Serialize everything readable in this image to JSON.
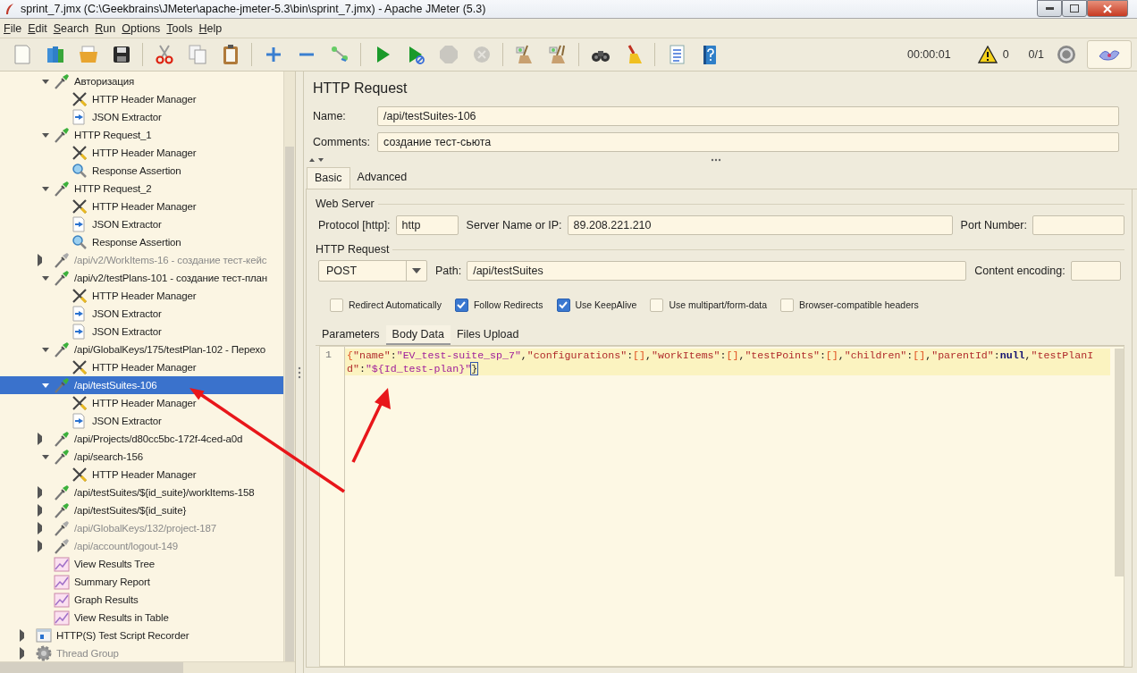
{
  "window": {
    "title": "sprint_7.jmx (C:\\Geekbrains\\JMeter\\apache-jmeter-5.3\\bin\\sprint_7.jmx) - Apache JMeter (5.3)"
  },
  "menu": [
    "File",
    "Edit",
    "Search",
    "Run",
    "Options",
    "Tools",
    "Help"
  ],
  "toolbar": [
    {
      "kind": "new",
      "disabled": false
    },
    {
      "kind": "templates",
      "disabled": false
    },
    {
      "kind": "open",
      "disabled": false
    },
    {
      "kind": "save",
      "disabled": false
    },
    {
      "kind": "separator"
    },
    {
      "kind": "cut",
      "disabled": false
    },
    {
      "kind": "copy",
      "disabled": false
    },
    {
      "kind": "paste",
      "disabled": false
    },
    {
      "kind": "separator"
    },
    {
      "kind": "expand",
      "disabled": false
    },
    {
      "kind": "collapse",
      "disabled": false
    },
    {
      "kind": "toggle",
      "disabled": false
    },
    {
      "kind": "separator"
    },
    {
      "kind": "start",
      "disabled": false
    },
    {
      "kind": "start-no-pause",
      "disabled": false
    },
    {
      "kind": "stop",
      "disabled": true
    },
    {
      "kind": "shutdown",
      "disabled": true
    },
    {
      "kind": "separator"
    },
    {
      "kind": "clear",
      "disabled": false
    },
    {
      "kind": "clear-all",
      "disabled": false
    },
    {
      "kind": "separator"
    },
    {
      "kind": "search",
      "disabled": false
    },
    {
      "kind": "reset-search",
      "disabled": false
    },
    {
      "kind": "separator"
    },
    {
      "kind": "function-helper",
      "disabled": false
    },
    {
      "kind": "help",
      "disabled": false
    }
  ],
  "status": {
    "timer": "00:00:01",
    "warnings": "0",
    "threads": "0/1"
  },
  "tree": {
    "items": [
      {
        "label": "Авторизация",
        "kind": "sampler",
        "expanded": true,
        "disabled": false,
        "selected": false,
        "children": [
          {
            "label": "HTTP Header Manager",
            "kind": "header",
            "disabled": false,
            "selected": false
          },
          {
            "label": "JSON Extractor",
            "kind": "extractor",
            "disabled": false,
            "selected": false
          }
        ]
      },
      {
        "label": "HTTP Request_1",
        "kind": "sampler",
        "expanded": true,
        "disabled": false,
        "selected": false,
        "children": [
          {
            "label": "HTTP Header Manager",
            "kind": "header",
            "disabled": false,
            "selected": false
          },
          {
            "label": "Response Assertion",
            "kind": "assertion",
            "disabled": false,
            "selected": false
          }
        ]
      },
      {
        "label": "HTTP Request_2",
        "kind": "sampler",
        "expanded": true,
        "disabled": false,
        "selected": false,
        "children": [
          {
            "label": "HTTP Header Manager",
            "kind": "header",
            "disabled": false,
            "selected": false
          },
          {
            "label": "JSON Extractor",
            "kind": "extractor",
            "disabled": false,
            "selected": false
          },
          {
            "label": "Response Assertion",
            "kind": "assertion",
            "disabled": false,
            "selected": false
          }
        ]
      },
      {
        "label": "/api/v2/WorkItems-16 - создание тест-кейс",
        "kind": "sampler",
        "expanded": false,
        "disabled": true,
        "selected": false
      },
      {
        "label": "/api/v2/testPlans-101 - создание тест-план",
        "kind": "sampler",
        "expanded": true,
        "disabled": false,
        "selected": false,
        "children": [
          {
            "label": "HTTP Header Manager",
            "kind": "header",
            "disabled": false,
            "selected": false
          },
          {
            "label": "JSON Extractor",
            "kind": "extractor",
            "disabled": false,
            "selected": false
          },
          {
            "label": "JSON Extractor",
            "kind": "extractor",
            "disabled": false,
            "selected": false
          }
        ]
      },
      {
        "label": "/api/GlobalKeys/175/testPlan-102 - Перехо",
        "kind": "sampler",
        "expanded": true,
        "disabled": false,
        "selected": false,
        "children": [
          {
            "label": "HTTP Header Manager",
            "kind": "header",
            "disabled": false,
            "selected": false
          }
        ]
      },
      {
        "label": "/api/testSuites-106",
        "kind": "sampler",
        "expanded": true,
        "disabled": false,
        "selected": true,
        "children": [
          {
            "label": "HTTP Header Manager",
            "kind": "header",
            "disabled": false,
            "selected": false
          },
          {
            "label": "JSON Extractor",
            "kind": "extractor",
            "disabled": false,
            "selected": false
          }
        ]
      },
      {
        "label": "/api/Projects/d80cc5bc-172f-4ced-a0d",
        "kind": "sampler",
        "expanded": false,
        "disabled": false,
        "selected": false
      },
      {
        "label": "/api/search-156",
        "kind": "sampler",
        "expanded": true,
        "disabled": false,
        "selected": false,
        "children": [
          {
            "label": "HTTP Header Manager",
            "kind": "header",
            "disabled": false,
            "selected": false
          }
        ]
      },
      {
        "label": "/api/testSuites/${id_suite}/workItems-158",
        "kind": "sampler",
        "expanded": false,
        "disabled": false,
        "selected": false
      },
      {
        "label": "/api/testSuites/${id_suite}",
        "kind": "sampler",
        "expanded": false,
        "disabled": false,
        "selected": false
      },
      {
        "label": "/api/GlobalKeys/132/project-187",
        "kind": "sampler",
        "expanded": false,
        "disabled": true,
        "selected": false
      },
      {
        "label": "/api/account/logout-149",
        "kind": "sampler",
        "expanded": false,
        "disabled": true,
        "selected": false
      },
      {
        "label": "View Results Tree",
        "kind": "listener",
        "disabled": false,
        "selected": false
      },
      {
        "label": "Summary Report",
        "kind": "listener",
        "disabled": false,
        "selected": false
      },
      {
        "label": "Graph Results",
        "kind": "listener",
        "disabled": false,
        "selected": false
      },
      {
        "label": "View Results in Table",
        "kind": "listener",
        "disabled": false,
        "selected": false
      }
    ],
    "roots": [
      {
        "label": "HTTP(S) Test Script Recorder",
        "kind": "recorder",
        "expanded": false,
        "disabled": false,
        "selected": false
      },
      {
        "label": "Thread Group",
        "kind": "threadgroup",
        "expanded": false,
        "disabled": true,
        "selected": false
      }
    ]
  },
  "panel": {
    "title": "HTTP Request",
    "name_label": "Name:",
    "name": "/api/testSuites-106",
    "comments_label": "Comments:",
    "comments": "создание тест-сьюта",
    "tabs": [
      {
        "label": "Basic",
        "selected": true
      },
      {
        "label": "Advanced",
        "selected": false
      }
    ],
    "web_server": {
      "legend": "Web Server",
      "protocol_label": "Protocol [http]:",
      "protocol": "http",
      "server_label": "Server Name or IP:",
      "server": "89.208.221.210",
      "port_label": "Port Number:"
    },
    "http_request": {
      "legend": "HTTP Request",
      "method": "POST",
      "path_label": "Path:",
      "path": "/api/testSuites",
      "encoding_label": "Content encoding:"
    },
    "options": [
      {
        "label": "Redirect Automatically",
        "checked": false
      },
      {
        "label": "Follow Redirects",
        "checked": true
      },
      {
        "label": "Use KeepAlive",
        "checked": true
      },
      {
        "label": "Use multipart/form-data",
        "checked": false
      },
      {
        "label": "Browser-compatible headers",
        "checked": false
      }
    ],
    "body_tabs": [
      {
        "label": "Parameters",
        "selected": false
      },
      {
        "label": "Body Data",
        "selected": true
      },
      {
        "label": "Files Upload",
        "selected": false
      }
    ],
    "body": {
      "line_number": "1",
      "tokens": [
        {
          "text": "{",
          "kind": "brace"
        },
        {
          "text": "\"name\"",
          "kind": "key"
        },
        {
          "text": ":",
          "kind": "punct"
        },
        {
          "text": "\"EV_test-suite_sp_7\"",
          "kind": "value"
        },
        {
          "text": ",",
          "kind": "punct"
        },
        {
          "text": "\"configurations\"",
          "kind": "key"
        },
        {
          "text": ":",
          "kind": "punct"
        },
        {
          "text": "[]",
          "kind": "brace"
        },
        {
          "text": ",",
          "kind": "punct"
        },
        {
          "text": "\"workItems\"",
          "kind": "key"
        },
        {
          "text": ":",
          "kind": "punct"
        },
        {
          "text": "[]",
          "kind": "brace"
        },
        {
          "text": ",",
          "kind": "punct"
        },
        {
          "text": "\"testPoints\"",
          "kind": "key"
        },
        {
          "text": ":",
          "kind": "punct"
        },
        {
          "text": "[]",
          "kind": "brace"
        },
        {
          "text": ",",
          "kind": "punct"
        },
        {
          "text": "\"children\"",
          "kind": "key"
        },
        {
          "text": ":",
          "kind": "punct"
        },
        {
          "text": "[]",
          "kind": "brace"
        },
        {
          "text": ",",
          "kind": "punct"
        },
        {
          "text": "\"parentId\"",
          "kind": "key"
        },
        {
          "text": ":",
          "kind": "punct"
        },
        {
          "text": "null",
          "kind": "literal"
        },
        {
          "text": ",",
          "kind": "punct"
        },
        {
          "text": "\"testPlanId\"",
          "kind": "key"
        },
        {
          "text": ":",
          "kind": "punct"
        },
        {
          "text": "\"${Id_test-plan}\"",
          "kind": "value"
        },
        {
          "text": "}",
          "kind": "match"
        }
      ]
    }
  }
}
